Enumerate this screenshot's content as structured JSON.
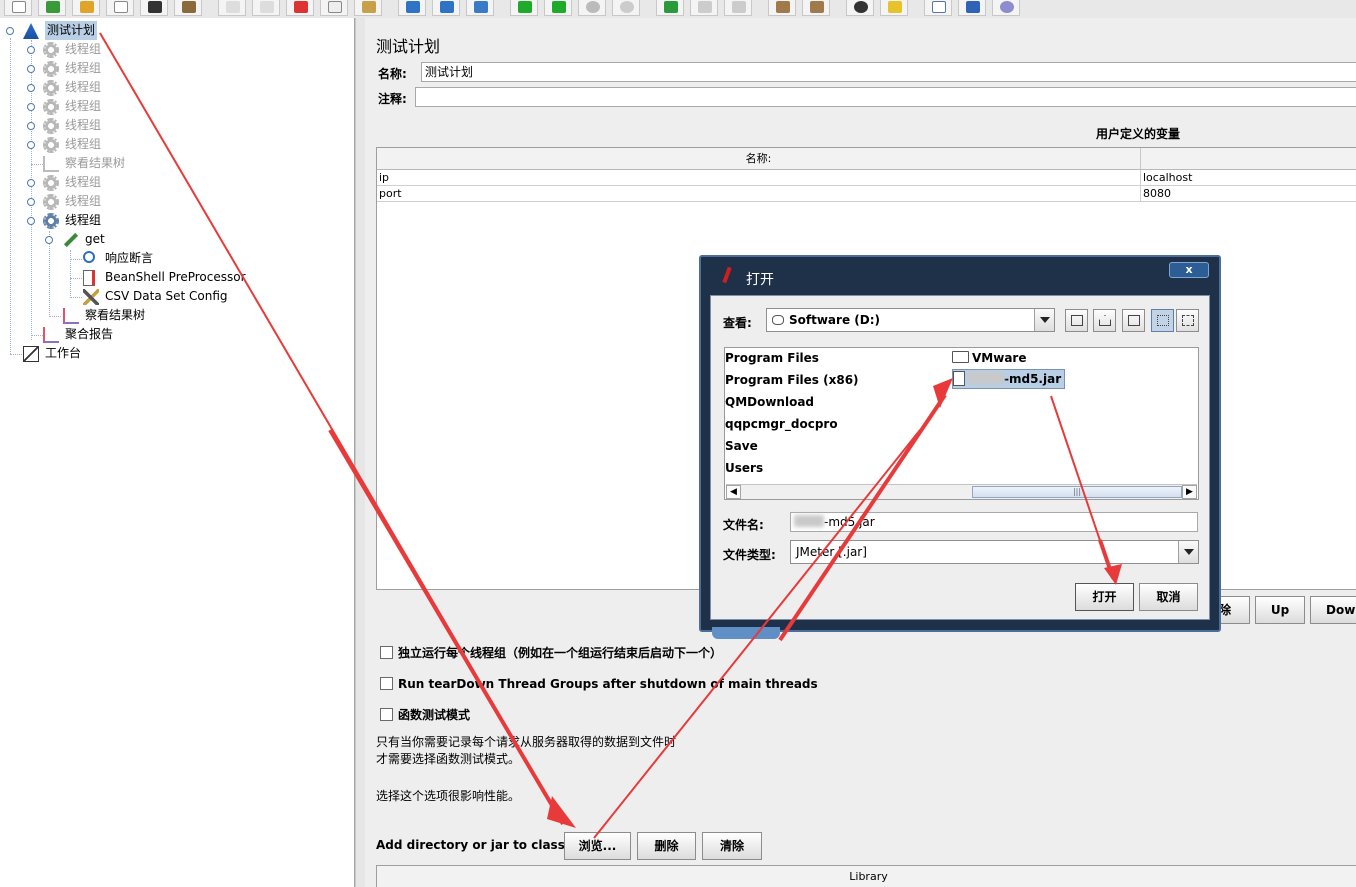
{
  "colors": {
    "arrow": "#e83a3a",
    "dialog_frame": "#1f3149",
    "selected": "#b8cfe5"
  },
  "tree": {
    "items": [
      {
        "label": "测试计划",
        "icon": "test-plan-icon",
        "selected": true
      },
      {
        "label": "线程组",
        "icon": "gear-icon",
        "disabled": true
      },
      {
        "label": "线程组",
        "icon": "gear-icon",
        "disabled": true
      },
      {
        "label": "线程组",
        "icon": "gear-icon",
        "disabled": true
      },
      {
        "label": "线程组",
        "icon": "gear-icon",
        "disabled": true
      },
      {
        "label": "线程组",
        "icon": "gear-icon",
        "disabled": true
      },
      {
        "label": "线程组",
        "icon": "gear-icon",
        "disabled": true
      },
      {
        "label": "察看结果树",
        "icon": "chart-icon",
        "disabled": true
      },
      {
        "label": "线程组",
        "icon": "gear-icon",
        "disabled": true
      },
      {
        "label": "线程组",
        "icon": "gear-icon",
        "disabled": true
      },
      {
        "label": "线程组",
        "icon": "gear-icon",
        "disabled": false
      },
      {
        "label": "get",
        "icon": "pipette-icon"
      },
      {
        "label": "响应断言",
        "icon": "magnifier-icon"
      },
      {
        "label": "BeanShell PreProcessor",
        "icon": "document-arrow-icon"
      },
      {
        "label": "CSV Data Set Config",
        "icon": "tools-icon"
      },
      {
        "label": "察看结果树",
        "icon": "chart-icon"
      },
      {
        "label": "聚合报告",
        "icon": "chart-icon"
      },
      {
        "label": "工作台",
        "icon": "workbench-icon"
      }
    ]
  },
  "main": {
    "title": "测试计划",
    "name_label": "名称:",
    "name_value": "测试计划",
    "comment_label": "注释:",
    "vars_title": "用户定义的变量",
    "vars_columns": [
      "名称:",
      ""
    ],
    "vars_rows": [
      [
        "ip",
        "localhost"
      ],
      [
        "port",
        "8080"
      ]
    ],
    "vars_buttons": [
      "除",
      "Up",
      "Down"
    ],
    "checkboxes": [
      "独立运行每个线程组（例如在一个组运行结束后启动下一个）",
      "Run tearDown Thread Groups after shutdown of main threads",
      "函数测试模式"
    ],
    "note_line1": "只有当你需要记录每个请求从服务器取得的数据到文件时",
    "note_line2": "才需要选择函数测试模式。",
    "note_line3": "选择这个选项很影响性能。",
    "classpath_label": "Add directory or jar to classpath",
    "classpath_buttons": [
      "浏览...",
      "删除",
      "清除"
    ],
    "library_header": "Library"
  },
  "dialog": {
    "title": "打开",
    "close": "x",
    "look_in_label": "查看:",
    "look_in_value": "Software (D:)",
    "files_col1": [
      "Program Files",
      "Program Files (x86)",
      "QMDownload",
      "qqpcmgr_docpro",
      "Save",
      "Users"
    ],
    "files_col2_folder": "VMware",
    "selected_file_suffix": "-md5.jar",
    "filename_label": "文件名:",
    "filename_suffix": "-md5.jar",
    "filetype_label": "文件类型:",
    "filetype_value": "JMeter [.jar]",
    "open_button": "打开",
    "cancel_button": "取消"
  }
}
